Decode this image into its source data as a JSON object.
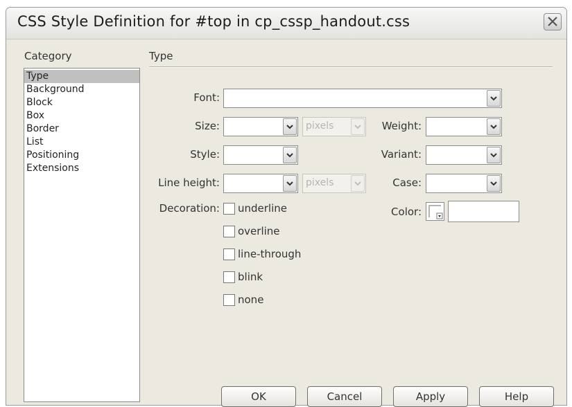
{
  "window": {
    "title": "CSS Style Definition for #top in cp_cssp_handout.css"
  },
  "category": {
    "header": "Category",
    "items": [
      "Type",
      "Background",
      "Block",
      "Box",
      "Border",
      "List",
      "Positioning",
      "Extensions"
    ],
    "selected": "Type"
  },
  "panel": {
    "header": "Type",
    "font": {
      "label": "Font:",
      "value": ""
    },
    "size": {
      "label": "Size:",
      "value": "",
      "unit": "pixels"
    },
    "weight": {
      "label": "Weight:",
      "value": ""
    },
    "style": {
      "label": "Style:",
      "value": ""
    },
    "variant": {
      "label": "Variant:",
      "value": ""
    },
    "line_height": {
      "label": "Line height:",
      "value": "",
      "unit": "pixels"
    },
    "case": {
      "label": "Case:",
      "value": ""
    },
    "decoration": {
      "label": "Decoration:",
      "options": [
        "underline",
        "overline",
        "line-through",
        "blink",
        "none"
      ]
    },
    "color": {
      "label": "Color:",
      "value": ""
    }
  },
  "buttons": {
    "ok": "OK",
    "cancel": "Cancel",
    "apply": "Apply",
    "help": "Help"
  }
}
